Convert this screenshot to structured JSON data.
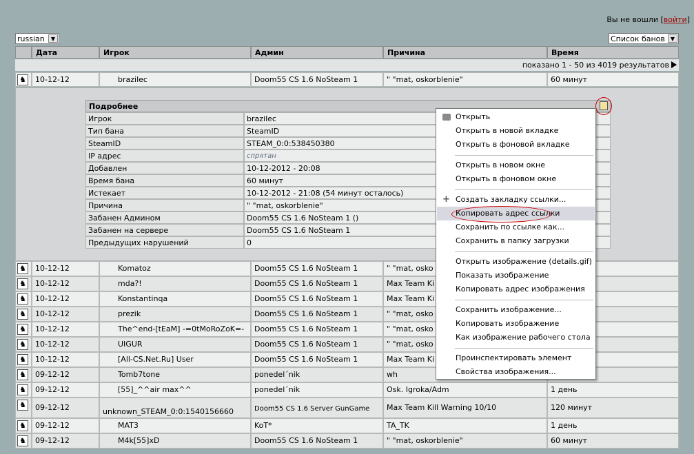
{
  "login": {
    "text": "Вы не вошли",
    "link": "войти"
  },
  "language": {
    "selected": "russian"
  },
  "list_select": {
    "selected": "Список банов"
  },
  "columns": [
    "Дата",
    "Игрок",
    "Админ",
    "Причина",
    "Время"
  ],
  "showing": "показано 1 - 50 из 4019 результатов",
  "first_row": {
    "date": "10-12-12",
    "player": "brazilec",
    "admin": "Doom55 CS 1.6 NoSteam 1",
    "reason": "\" \"mat, oskorblenie\"",
    "time": "60 минут"
  },
  "details": {
    "title": "Подробнее",
    "rows": [
      {
        "label": "Игрок",
        "value": "brazilec"
      },
      {
        "label": "Тип бана",
        "value": "SteamID"
      },
      {
        "label": "SteamID",
        "value": "STEAM_0:0:538450380"
      },
      {
        "label": "IP адрес",
        "value": "спрятан"
      },
      {
        "label": "Добавлен",
        "value": "10-12-2012 - 20:08"
      },
      {
        "label": "Время бана",
        "value": "60  минут"
      },
      {
        "label": "Истекает",
        "value": "10-12-2012 - 21:08  (54 минут осталось)"
      },
      {
        "label": "Причина",
        "value": "\" \"mat, oskorblenie\""
      },
      {
        "label": "Забанен Админом",
        "value": "Doom55 CS 1.6 NoSteam 1 ()"
      },
      {
        "label": "Забанен на сервере",
        "value": "Doom55 CS 1.6 NoSteam 1"
      },
      {
        "label": "Предыдущих нарушений",
        "value": "0"
      }
    ]
  },
  "rows": [
    {
      "date": "10-12-12",
      "player": "Komatoz",
      "admin": "Doom55 CS 1.6 NoSteam 1",
      "reason": "\" \"mat, osko",
      "time": ""
    },
    {
      "date": "10-12-12",
      "player": "mda?!",
      "admin": "Doom55 CS 1.6 NoSteam 1",
      "reason": "Max Team Ki",
      "time": ""
    },
    {
      "date": "10-12-12",
      "player": "Konstantinqa",
      "admin": "Doom55 CS 1.6 NoSteam 1",
      "reason": "Max Team Ki",
      "time": ""
    },
    {
      "date": "10-12-12",
      "player": "prezik",
      "admin": "Doom55 CS 1.6 NoSteam 1",
      "reason": "\" \"mat, osko",
      "time": ""
    },
    {
      "date": "10-12-12",
      "player": "The^end-[tEaM] -=0tMoRoZoK=-",
      "admin": "Doom55 CS 1.6 NoSteam 1",
      "reason": "\" \"mat, osko",
      "time": ""
    },
    {
      "date": "10-12-12",
      "player": "UIGUR",
      "admin": "Doom55 CS 1.6 NoSteam 1",
      "reason": "\" \"mat, osko",
      "time": ""
    },
    {
      "date": "10-12-12",
      "player": "[All-CS.Net.Ru] User",
      "admin": "Doom55 CS 1.6 NoSteam 1",
      "reason": "Max Team Ki",
      "time": ""
    },
    {
      "date": "09-12-12",
      "player": "Tomb7tone",
      "admin": "ponedel´nik",
      "reason": "wh",
      "time": ""
    },
    {
      "date": "09-12-12",
      "player": "[55]_^^air max^^",
      "admin": "ponedel´nik",
      "reason": "Osk. Igroka/Adm",
      "time": "1 день"
    },
    {
      "date": "09-12-12",
      "player": "unknown_STEAM_0:0:1540156660",
      "admin": "Doom55 CS 1.6 Server GunGame",
      "reason": "Max Team Kill Warning 10/10",
      "time": "120 минут"
    },
    {
      "date": "09-12-12",
      "player": "MAT3",
      "admin": "KoT*",
      "reason": "TA_TK",
      "time": "1 день"
    },
    {
      "date": "09-12-12",
      "player": "M4k[55]xD",
      "admin": "Doom55 CS 1.6 NoSteam 1",
      "reason": "\" \"mat, oskorblenie\"",
      "time": "60 минут"
    }
  ],
  "context_menu": {
    "items": [
      "Открыть",
      "Открыть в новой вкладке",
      "Открыть в фоновой вкладке",
      "Открыть в новом окне",
      "Открыть в фоновом окне",
      "Создать закладку ссылки...",
      "Копировать адрес ссылки",
      "Сохранить по ссылке как...",
      "Сохранить в папку загрузки",
      "Открыть изображение (details.gif)",
      "Показать изображение",
      "Копировать адрес изображения",
      "Сохранить изображение...",
      "Копировать изображение",
      "Как изображение рабочего стола",
      "Проинспектировать элемент",
      "Свойства изображения..."
    ],
    "highlighted": "Копировать адрес ссылки"
  }
}
